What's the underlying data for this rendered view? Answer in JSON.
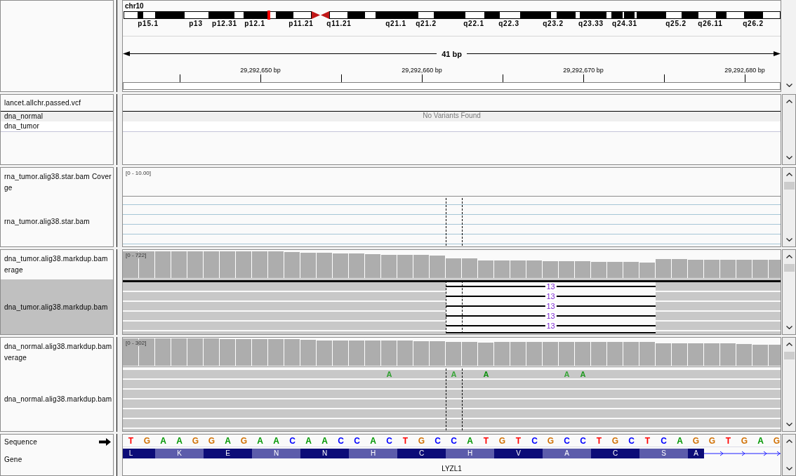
{
  "header": {
    "chromosome": "chr10",
    "cytobands": [
      "p15.1",
      "p13",
      "p12.31",
      "p12.1",
      "p11.21",
      "q11.21",
      "q21.1",
      "q21.2",
      "q22.1",
      "q22.3",
      "q23.2",
      "q23.33",
      "q24.31",
      "q25.2",
      "q26.11",
      "q26.2"
    ],
    "span": "41 bp",
    "ticks": [
      "29,292,650 bp",
      "29,292,660 bp",
      "29,292,670 bp",
      "29,292,680 bp"
    ]
  },
  "variant_panel": {
    "track": {
      "name": "lancet.allchr.passed.vcf",
      "selected": false
    },
    "samples": [
      {
        "name": "dna_normal"
      },
      {
        "name": "dna_tumor"
      }
    ],
    "message": "No Variants Found"
  },
  "alignment_panels": [
    {
      "kind": "empty",
      "coverage": {
        "label_lines": [
          "rna_tumor.alig38.star.bam Cover",
          "ge"
        ],
        "range": "[0 - 10.00]",
        "selected": false
      },
      "reads": {
        "name": "rna_tumor.alig38.star.bam",
        "selected": false
      }
    },
    {
      "kind": "reads",
      "coverage": {
        "label_lines": [
          "dna_tumor.alig38.markdup.bam",
          "erage"
        ],
        "range": "[0 - 722]",
        "selected": false
      },
      "reads": {
        "name": "dna_tumor.alig38.markdup.bam",
        "selected": true,
        "downsampled": true,
        "rows": [
          {
            "kind": "split",
            "junction": "13"
          },
          {
            "kind": "split",
            "junction": "13"
          },
          {
            "kind": "split",
            "junction": "13"
          },
          {
            "kind": "split",
            "junction": "13"
          },
          {
            "kind": "split",
            "junction": "13"
          },
          {
            "kind": "split"
          }
        ]
      }
    },
    {
      "kind": "reads",
      "coverage": {
        "label_lines": [
          "dna_normal.alig38.markdup.bam",
          "verage"
        ],
        "range": "[0 - 302]",
        "selected": false
      },
      "reads": {
        "name": "dna_normal.alig38.markdup.bam",
        "selected": false,
        "downsampled": false,
        "rows": [
          {
            "kind": "full",
            "mismatches": [
              {
                "base": "A",
                "color": "#2f9e2f"
              },
              {
                "base": "A",
                "color": "#3aa63a"
              },
              {
                "base": "A",
                "color": "#0a8f0a"
              },
              {
                "base": "A",
                "color": "#38a438"
              },
              {
                "base": "A",
                "color": "#1f981f"
              }
            ]
          },
          {
            "kind": "full"
          },
          {
            "kind": "full"
          },
          {
            "kind": "full"
          },
          {
            "kind": "full"
          },
          {
            "kind": "full"
          },
          {
            "kind": "full"
          }
        ]
      }
    }
  ],
  "reference": {
    "sequence_label": "Sequence",
    "gene_label": "Gene",
    "bases": [
      {
        "base": "T",
        "color": "#ff0000"
      },
      {
        "base": "G",
        "color": "#d17105"
      },
      {
        "base": "A",
        "color": "#009600"
      },
      {
        "base": "A",
        "color": "#009600"
      },
      {
        "base": "G",
        "color": "#d17105"
      },
      {
        "base": "G",
        "color": "#d17105"
      },
      {
        "base": "A",
        "color": "#009600"
      },
      {
        "base": "G",
        "color": "#d17105"
      },
      {
        "base": "A",
        "color": "#009600"
      },
      {
        "base": "A",
        "color": "#009600"
      },
      {
        "base": "C",
        "color": "#0000ff"
      },
      {
        "base": "A",
        "color": "#009600"
      },
      {
        "base": "A",
        "color": "#009600"
      },
      {
        "base": "C",
        "color": "#0000ff"
      },
      {
        "base": "C",
        "color": "#0000ff"
      },
      {
        "base": "A",
        "color": "#009600"
      },
      {
        "base": "C",
        "color": "#0000ff"
      },
      {
        "base": "T",
        "color": "#ff0000"
      },
      {
        "base": "G",
        "color": "#d17105"
      },
      {
        "base": "C",
        "color": "#0000ff"
      },
      {
        "base": "C",
        "color": "#0000ff"
      },
      {
        "base": "A",
        "color": "#009600"
      },
      {
        "base": "T",
        "color": "#ff0000"
      },
      {
        "base": "G",
        "color": "#d17105"
      },
      {
        "base": "T",
        "color": "#ff0000"
      },
      {
        "base": "C",
        "color": "#0000ff"
      },
      {
        "base": "G",
        "color": "#d17105"
      },
      {
        "base": "C",
        "color": "#0000ff"
      },
      {
        "base": "C",
        "color": "#0000ff"
      },
      {
        "base": "T",
        "color": "#ff0000"
      },
      {
        "base": "G",
        "color": "#d17105"
      },
      {
        "base": "C",
        "color": "#0000ff"
      },
      {
        "base": "T",
        "color": "#ff0000"
      },
      {
        "base": "C",
        "color": "#0000ff"
      },
      {
        "base": "A",
        "color": "#009600"
      },
      {
        "base": "G",
        "color": "#d17105"
      },
      {
        "base": "G",
        "color": "#d17105"
      },
      {
        "base": "T",
        "color": "#ff0000"
      },
      {
        "base": "G",
        "color": "#d17105"
      },
      {
        "base": "A",
        "color": "#009600"
      },
      {
        "base": "G",
        "color": "#d17105"
      }
    ],
    "amino_acids": [
      "L",
      "K",
      "E",
      "N",
      "N",
      "H",
      "C",
      "H",
      "V",
      "A",
      "C",
      "S",
      "A"
    ],
    "gene_name": "LYZL1"
  }
}
